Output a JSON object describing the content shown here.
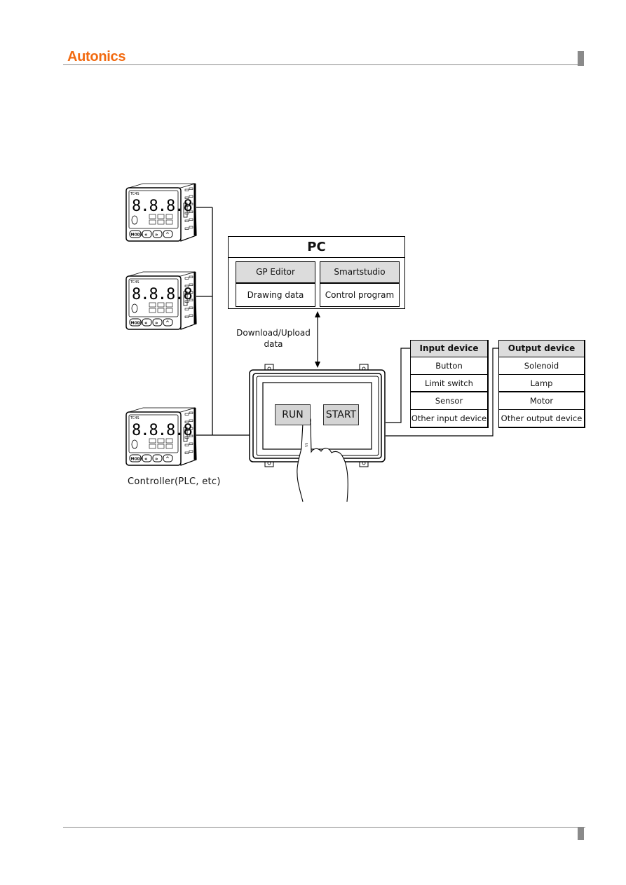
{
  "header": {
    "brand": "Autonics",
    "brand_color": "#f26a10",
    "rule_color": "#8a8a8a"
  },
  "diagram": {
    "pc": {
      "title": "PC",
      "software": [
        {
          "name": "GP Editor",
          "function": "Drawing data"
        },
        {
          "name": "Smartstudio",
          "function": "Control program"
        }
      ]
    },
    "link_label_line1": "Download/Upload",
    "link_label_line2": "data",
    "hmi": {
      "buttons": [
        "RUN",
        "START"
      ]
    },
    "controllers": {
      "count": 3,
      "display": "8.8.8.8",
      "model_tag": "TC4S",
      "keys": [
        "MODE",
        "«",
        "»",
        "^"
      ],
      "label": "Controller(PLC, etc)"
    },
    "input_device": {
      "title": "Input device",
      "items": [
        "Button",
        "Limit switch",
        "Sensor",
        "Other input device"
      ]
    },
    "output_device": {
      "title": "Output device",
      "items": [
        "Solenoid",
        "Lamp",
        "Motor",
        "Other output device"
      ]
    }
  }
}
